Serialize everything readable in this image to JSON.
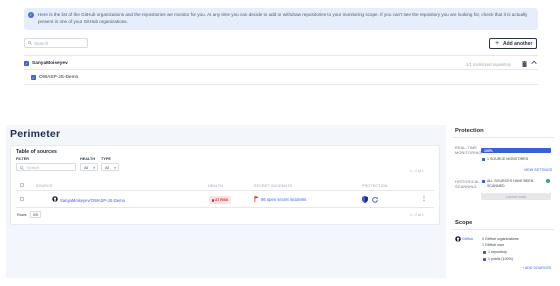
{
  "banner": {
    "text": "Here is the list of the GitHub organizations and the repositories we monitor for you. At any time you can decide to add or withdraw repositories to your monitoring scope. If you can't see the repository you are looking for, check that it is actually present in one of your GitHub organizations."
  },
  "search": {
    "placeholder": "Search"
  },
  "add_button": {
    "label": "Add another"
  },
  "org": {
    "name": "SanyaMoiseyev",
    "monitored_text": "1/1 monitored repository",
    "repos": [
      {
        "name": "OWASP-JS-Demo"
      }
    ]
  },
  "perimeter": {
    "title": "Perimeter",
    "table_title": "Table of sources",
    "filter_label": "FILTER",
    "filter_placeholder": "Search",
    "health_label": "HEALTH",
    "health_value": "All",
    "type_label": "TYPE",
    "type_value": "All",
    "pager_top": "1 - 1 of 1",
    "columns": [
      "SOURCE",
      "HEALTH",
      "SECRET INCIDENTS",
      "PROTECTION"
    ],
    "rows": [
      {
        "source": "SanyaMoiseyev/OWASP-JS-Demo",
        "health": "AT RISK",
        "incidents": "66 open secret incidents"
      }
    ],
    "rows_label": "Rows",
    "rows_value": "5/5",
    "pager_bottom": "1 - 1 of 1"
  },
  "protection": {
    "title": "Protection",
    "realtime_label": "REAL-TIME MONITORING",
    "progress_percent": 100,
    "progress_text": "100%",
    "sources_monitored": "1 SOURCE MONITORED",
    "view_settings": "VIEW SETTINGS",
    "historical_label": "HISTORICAL SCANNING",
    "scanned_text": "ALL SOURCES HAVE BEEN SCANNED",
    "launch_button": "Launch scan"
  },
  "scope": {
    "title": "Scope",
    "provider": "GitHub",
    "orgs": "0 GitHub organizations",
    "users": "1 GitHub user",
    "repos": "1 repository",
    "public": "1 public (100%)",
    "add_sources": "ADD SOURCES"
  },
  "colors": {
    "accent": "#3b5fd9",
    "risk": "#dc2626",
    "banner_bg": "#e7eefb",
    "perimeter_bg": "#f3f6fb"
  }
}
